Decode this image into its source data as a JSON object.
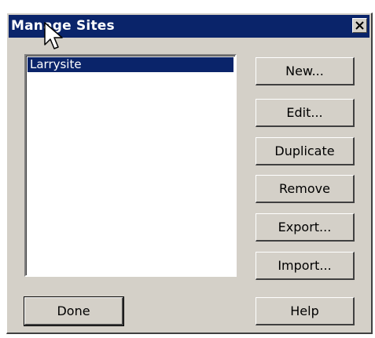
{
  "window": {
    "title": "Manage Sites"
  },
  "close_label": "×",
  "sites": [
    {
      "label": "Larrysite",
      "selected": true
    }
  ],
  "buttons": {
    "new": "New...",
    "edit": "Edit...",
    "duplicate": "Duplicate",
    "remove": "Remove",
    "export": "Export...",
    "import": "Import...",
    "done": "Done",
    "help": "Help"
  },
  "colors": {
    "titlebar": "#0a246a",
    "face": "#d4d0c8",
    "selection": "#0a246a"
  },
  "icons": {
    "close": "close-icon",
    "cursor": "mouse-pointer-icon"
  }
}
